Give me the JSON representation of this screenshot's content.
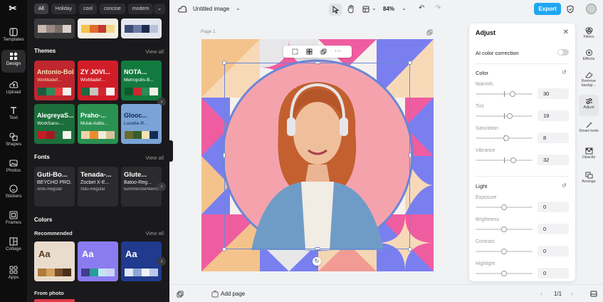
{
  "rail": {
    "items": [
      {
        "label": "Templates"
      },
      {
        "label": "Design"
      },
      {
        "label": "Upload"
      },
      {
        "label": "Text"
      },
      {
        "label": "Shapes"
      },
      {
        "label": "Photos"
      },
      {
        "label": "Stickers"
      },
      {
        "label": "Frames"
      },
      {
        "label": "Collage"
      },
      {
        "label": "Apps"
      }
    ],
    "active": "Design"
  },
  "panel": {
    "chips": [
      "All",
      "Holiday",
      "cool",
      "concise",
      "modern"
    ],
    "themes_title": "Themes",
    "view_all": "View all",
    "themes": [
      {
        "title": "Antonio-Bold",
        "sub": "WixMadef...",
        "bg": "#c0262e",
        "fg": "#f4e1b0",
        "sw": [
          "#1d5b3c",
          "#2c8b5b",
          "#e93a3d",
          "#f4f1ea"
        ]
      },
      {
        "title": "ZY JOVI...",
        "sub": "WixMadef...",
        "bg": "#d11d28",
        "fg": "#ffffff",
        "sw": [
          "#1c6a40",
          "#c7c4bf",
          "#d32634",
          "#f7f2ec"
        ]
      },
      {
        "title": "NOTA...",
        "sub": "Metropolis-B...",
        "bg": "#127a3e",
        "fg": "#ffffff",
        "sw": [
          "#0d5a2c",
          "#ce2733",
          "#2a8b55",
          "#f3efe8"
        ]
      },
      {
        "title": "AlegreyaS...",
        "sub": "WorkSans-...",
        "bg": "#1b6f3b",
        "fg": "#ffffff",
        "sw": [
          "#c11d24",
          "#a31a20",
          "#1e6e3f",
          "#f6f4ef"
        ]
      },
      {
        "title": "Praho-...",
        "sub": "Mulat-Addo...",
        "bg": "#2a9152",
        "fg": "#ffffff",
        "sw": [
          "#f2d2a8",
          "#e88c2e",
          "#f6ecd8",
          "#d8c39c"
        ]
      },
      {
        "title": "Glooc...",
        "sub": "Lucette-R...",
        "bg": "#7ba4d6",
        "fg": "#10294f",
        "sw": [
          "#6a6b2d",
          "#365e2c",
          "#f2e1b2",
          "#122c55"
        ]
      }
    ],
    "top_partial_swatches": [
      [
        "#c8b8ad",
        "#9a8a82",
        "#7b6e69",
        "#ddd3cc"
      ],
      [
        "#f2c24b",
        "#e36b2d",
        "#c23a2d",
        "#f6d889"
      ],
      [
        "#3b4b74",
        "#6a78a2",
        "#1f2a4a",
        "#b9c1d8"
      ]
    ],
    "fonts_title": "Fonts",
    "fonts": [
      {
        "f1": "Guti-Bo...",
        "f2": "BEYCHO PRO...",
        "f3": "Anto-Regular"
      },
      {
        "f1": "Tenada-...",
        "f2": "Zocbel X-E...",
        "f3": "Stilu-Regular"
      },
      {
        "f1": "Glute...",
        "f2": "Baloo-Reg...",
        "f3": "kummershehiten0o"
      }
    ],
    "colors_title": "Colors",
    "recommended_title": "Recommended",
    "colors": [
      {
        "aa": "Aa",
        "bg": "#e9dccd",
        "fg": "#5a3b22",
        "sw": [
          "#b07a3a",
          "#d3a25e",
          "#7a4e2a",
          "#4b2e1a"
        ]
      },
      {
        "aa": "Aa",
        "bg": "#8a7cf0",
        "fg": "#ffffff",
        "sw": [
          "#403e8c",
          "#2a9d9a",
          "#bfe7f0",
          "#cfd4f8"
        ]
      },
      {
        "aa": "Aa",
        "bg": "#203a8e",
        "fg": "#ffffff",
        "sw": [
          "#dfe7f6",
          "#8fa6d6",
          "#f0f2f7",
          "#b9c8e8"
        ]
      }
    ],
    "from_photo": "From photo"
  },
  "topbar": {
    "doc_name": "Untitled image",
    "zoom": "84%",
    "export": "Export"
  },
  "canvas": {
    "page_label": "Page 1"
  },
  "bottombar": {
    "add_page": "Add page",
    "pager": "1/1"
  },
  "adjust": {
    "title": "Adjust",
    "ai_label": "AI color correction",
    "color_title": "Color",
    "light_title": "Light",
    "color_sliders": [
      {
        "label": "Warmth",
        "value": "30",
        "level": 0.65
      },
      {
        "label": "Tint",
        "value": "19",
        "level": 0.6
      },
      {
        "label": "Saturation",
        "value": "8",
        "level": 0.54
      },
      {
        "label": "Vibrance",
        "value": "32",
        "level": 0.66
      }
    ],
    "light_sliders": [
      {
        "label": "Exposure",
        "value": "0",
        "level": 0.5
      },
      {
        "label": "Brightness",
        "value": "0",
        "level": 0.5
      },
      {
        "label": "Contrast",
        "value": "0",
        "level": 0.5
      },
      {
        "label": "Highlight",
        "value": "0",
        "level": 0.5
      }
    ]
  },
  "right_rail": {
    "items": [
      {
        "label": "Filters"
      },
      {
        "label": "Effects"
      },
      {
        "label": "Remove backgr..."
      },
      {
        "label": "Adjust"
      },
      {
        "label": "Smart tools"
      },
      {
        "label": "Opacity"
      },
      {
        "label": "Arrange"
      }
    ],
    "active": "Adjust"
  },
  "colors": {
    "accent": "#1fa7f0",
    "selection": "#6b86d6"
  }
}
